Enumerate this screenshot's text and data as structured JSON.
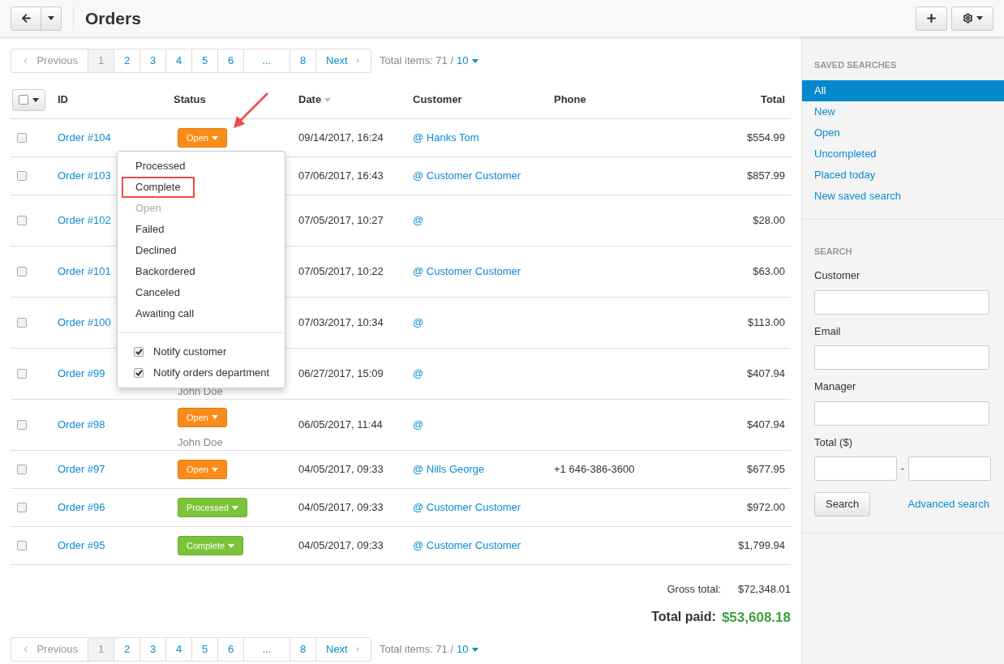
{
  "header": {
    "title": "Orders"
  },
  "pagination_top": {
    "previous": {
      "label": "Previous",
      "disabled": true
    },
    "pages": [
      {
        "label": "1",
        "selected": true
      },
      {
        "label": "2",
        "selected": false
      },
      {
        "label": "3",
        "selected": false
      },
      {
        "label": "4",
        "selected": false
      },
      {
        "label": "5",
        "selected": false
      },
      {
        "label": "6",
        "selected": false
      },
      {
        "label": "...",
        "selected": false
      },
      {
        "label": "8",
        "selected": false
      }
    ],
    "next": {
      "label": "Next",
      "disabled": false
    },
    "total_label": "Total items: 71 /",
    "per_page": "10"
  },
  "table": {
    "select_all": {
      "checked": false
    },
    "columns": [
      {
        "label": "ID",
        "sorted": false
      },
      {
        "label": "Status",
        "sorted": false
      },
      {
        "label": "Date",
        "sorted": true
      },
      {
        "label": "Customer",
        "sorted": false
      },
      {
        "label": "Phone",
        "sorted": false
      },
      {
        "label": "Total",
        "sorted": false
      }
    ],
    "rows": [
      {
        "id": "Order #104",
        "status": {
          "label": "Open",
          "kind": "open"
        },
        "date": "09/14/2017, 16:24",
        "customer": "@ Hanks Tom",
        "total": "$554.99",
        "tall": false,
        "checked": false
      },
      {
        "id": "Order #103",
        "date": "07/06/2017, 16:43",
        "customer": "@ Customer Customer",
        "total": "$857.99",
        "tall": false,
        "checked": false
      },
      {
        "id": "Order #102",
        "date": "07/05/2017, 10:27",
        "customer": "@",
        "total": "$28.00",
        "tall": true,
        "checked": false
      },
      {
        "id": "Order #101",
        "date": "07/05/2017, 10:22",
        "customer": "@ Customer Customer",
        "total": "$63.00",
        "tall": true,
        "checked": false
      },
      {
        "id": "Order #100",
        "date": "07/03/2017, 10:34",
        "customer": "@",
        "total": "$113.00",
        "tall": true,
        "checked": false
      },
      {
        "id": "Order #99",
        "manager": "John Doe",
        "date": "06/27/2017, 15:09",
        "customer": "@",
        "total": "$407.94",
        "tall": true,
        "checked": false
      },
      {
        "id": "Order #98",
        "status": {
          "label": "Open",
          "kind": "open"
        },
        "manager": "John Doe",
        "date": "06/05/2017, 11:44",
        "customer": "@",
        "total": "$407.94",
        "tall": true,
        "checked": false
      },
      {
        "id": "Order #97",
        "status": {
          "label": "Open",
          "kind": "open"
        },
        "date": "04/05/2017, 09:33",
        "customer": "@ Nills George",
        "phone": "+1 646-386-3600",
        "total": "$677.95",
        "tall": false,
        "checked": false
      },
      {
        "id": "Order #96",
        "status": {
          "label": "Processed",
          "kind": "done"
        },
        "date": "04/05/2017, 09:33",
        "customer": "@ Customer Customer",
        "total": "$972.00",
        "tall": false,
        "checked": false
      },
      {
        "id": "Order #95",
        "status": {
          "label": "Complete",
          "kind": "done"
        },
        "date": "04/05/2017, 09:33",
        "customer": "@ Customer Customer",
        "total": "$1,799.94",
        "tall": false,
        "checked": false
      }
    ]
  },
  "status_menu": {
    "options": [
      {
        "label": "Processed",
        "disabled": false,
        "highlighted": false
      },
      {
        "label": "Complete",
        "disabled": false,
        "highlighted": true
      },
      {
        "label": "Open",
        "disabled": true,
        "highlighted": false
      },
      {
        "label": "Failed",
        "disabled": false,
        "highlighted": false
      },
      {
        "label": "Declined",
        "disabled": false,
        "highlighted": false
      },
      {
        "label": "Backordered",
        "disabled": false,
        "highlighted": false
      },
      {
        "label": "Canceled",
        "disabled": false,
        "highlighted": false
      },
      {
        "label": "Awaiting call",
        "disabled": false,
        "highlighted": false
      }
    ],
    "notify": [
      {
        "label": "Notify customer",
        "checked": true
      },
      {
        "label": "Notify orders department",
        "checked": true
      }
    ]
  },
  "totals": {
    "gross_label": "Gross total:",
    "gross": "$72,348.01",
    "paid_label": "Total paid:",
    "paid": "$53,608.18"
  },
  "pagination_bottom": {
    "previous": {
      "label": "Previous",
      "disabled": true
    },
    "pages": [
      {
        "label": "1",
        "selected": true
      },
      {
        "label": "2",
        "selected": false
      },
      {
        "label": "3",
        "selected": false
      },
      {
        "label": "4",
        "selected": false
      },
      {
        "label": "5",
        "selected": false
      },
      {
        "label": "6",
        "selected": false
      },
      {
        "label": "...",
        "selected": false
      },
      {
        "label": "8",
        "selected": false
      }
    ],
    "next": {
      "label": "Next",
      "disabled": false
    },
    "total_label": "Total items: 71 /",
    "per_page": "10"
  },
  "sidebar": {
    "saved_title": "SAVED SEARCHES",
    "saved": [
      {
        "label": "All",
        "selected": true
      },
      {
        "label": "New",
        "selected": false
      },
      {
        "label": "Open",
        "selected": false
      },
      {
        "label": "Uncompleted",
        "selected": false
      },
      {
        "label": "Placed today",
        "selected": false
      },
      {
        "label": "New saved search",
        "selected": false
      }
    ],
    "search_title": "SEARCH",
    "fields": [
      {
        "label": "Customer"
      },
      {
        "label": "Email"
      },
      {
        "label": "Manager"
      }
    ],
    "total_label": "Total ($)",
    "range_sep": "-",
    "search_button": "Search",
    "advanced": "Advanced search"
  }
}
